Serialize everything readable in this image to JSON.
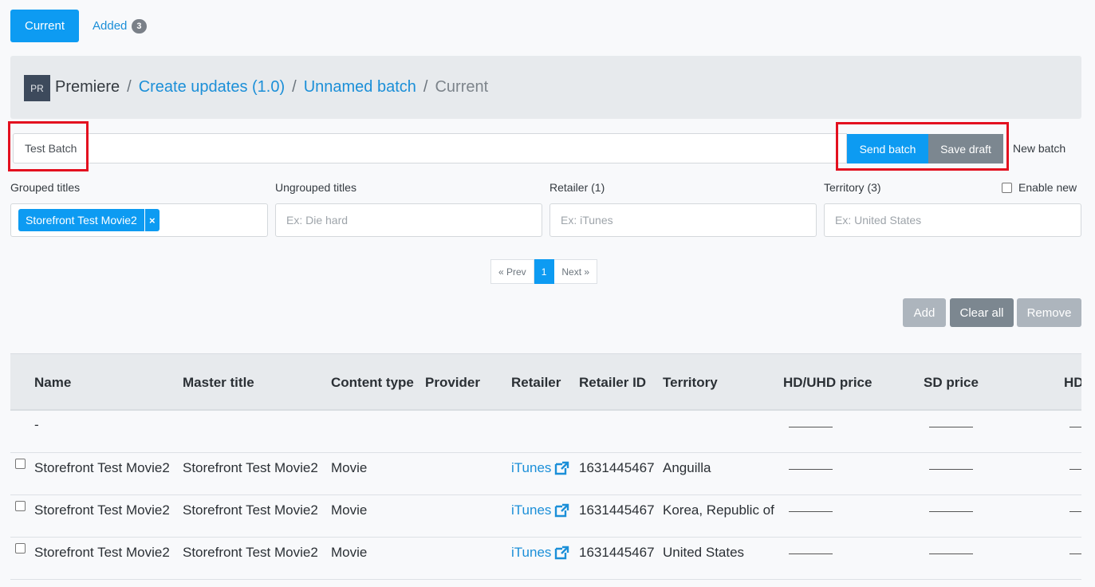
{
  "tabs": {
    "current": "Current",
    "added": "Added",
    "added_count": "3"
  },
  "breadcrumb": {
    "logo": "PR",
    "home": "Premiere",
    "sep": "/",
    "items": [
      "Create updates (1.0)",
      "Unnamed batch"
    ],
    "current": "Current"
  },
  "batch": {
    "name_value": "Test Batch",
    "send_label": "Send batch",
    "save_label": "Save draft",
    "new_label": "New batch"
  },
  "filters": {
    "grouped_label": "Grouped titles",
    "grouped_tag": "Storefront Test Movie2",
    "grouped_tag_remove": "×",
    "ungrouped_label": "Ungrouped titles",
    "ungrouped_placeholder": "Ex: Die hard",
    "retailer_label": "Retailer (1)",
    "retailer_placeholder": "Ex: iTunes",
    "territory_label": "Territory (3)",
    "territory_placeholder": "Ex: United States",
    "enable_new_label": "Enable new"
  },
  "pagination": {
    "prev": "« Prev",
    "page": "1",
    "next": "Next »"
  },
  "actions": {
    "add": "Add",
    "clear_all": "Clear all",
    "remove": "Remove"
  },
  "table": {
    "headers": [
      "Name",
      "Master title",
      "Content type",
      "Provider",
      "Retailer",
      "Retailer ID",
      "Territory",
      "HD/UHD price",
      "SD price",
      "HD"
    ],
    "group_row": {
      "name": "-"
    },
    "rows": [
      {
        "name": "Storefront Test Movie2",
        "master_title": "Storefront Test Movie2",
        "content_type": "Movie",
        "provider": "",
        "retailer": "iTunes",
        "retailer_id": "1631445467",
        "territory": "Anguilla"
      },
      {
        "name": "Storefront Test Movie2",
        "master_title": "Storefront Test Movie2",
        "content_type": "Movie",
        "provider": "",
        "retailer": "iTunes",
        "retailer_id": "1631445467",
        "territory": "Korea, Republic of"
      },
      {
        "name": "Storefront Test Movie2",
        "master_title": "Storefront Test Movie2",
        "content_type": "Movie",
        "provider": "",
        "retailer": "iTunes",
        "retailer_id": "1631445467",
        "territory": "United States"
      }
    ]
  },
  "colors": {
    "primary": "#0d9bf2",
    "secondary": "#7c8790",
    "disabled": "#adb5bd",
    "link": "#1b8fd8",
    "highlight": "#e3101f"
  }
}
